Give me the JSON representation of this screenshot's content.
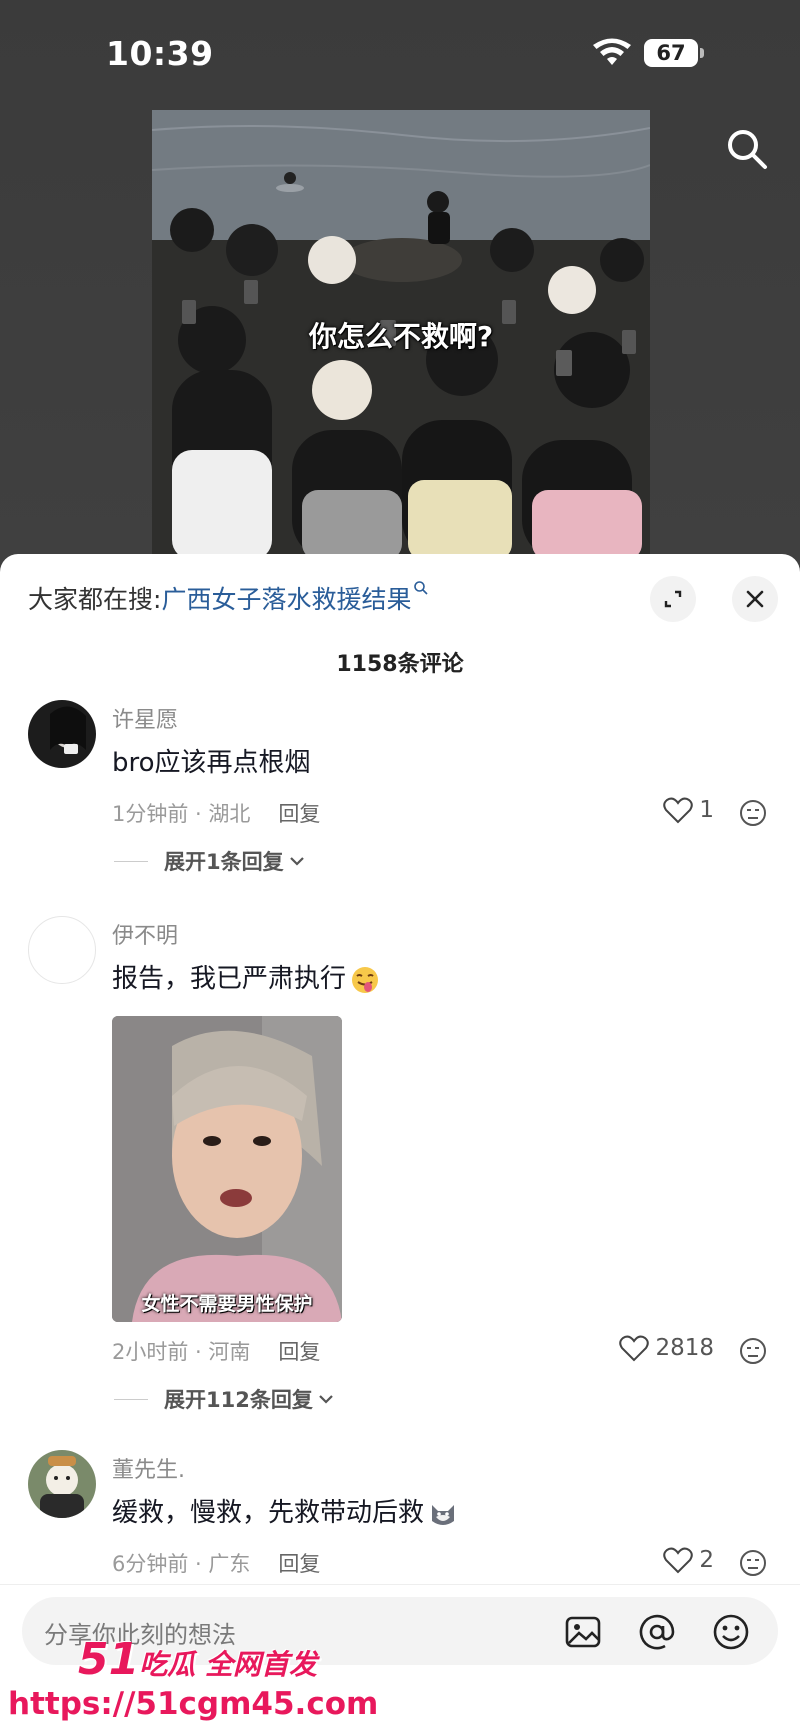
{
  "status_bar": {
    "time": "10:39",
    "battery": "67"
  },
  "video": {
    "caption": "你怎么不救啊?"
  },
  "sheet": {
    "search_hint_prefix": "大家都在搜:",
    "search_hint_query": "广西女子落水救援结果",
    "comment_count": "1158条评论"
  },
  "comments": [
    {
      "username": "许星愿",
      "text": "bro应该再点根烟",
      "meta": "1分钟前 · 湖北",
      "reply": "回复",
      "likes": "1",
      "expand": "展开1条回复"
    },
    {
      "username": "伊不明",
      "text": "报告，我已严肃执行",
      "image_caption": "女性不需要男性保护",
      "meta": "2小时前 · 河南",
      "reply": "回复",
      "likes": "2818",
      "expand": "展开112条回复"
    },
    {
      "username": "董先生.",
      "text": "缓救，慢救，先救带动后救",
      "meta": "6分钟前 · 广东",
      "reply": "回复",
      "likes": "2"
    }
  ],
  "input": {
    "placeholder": "分享你此刻的想法"
  },
  "watermark": {
    "logo_num": "51",
    "logo_text": "吃瓜 全网首发",
    "url": "https://51cgm45.com"
  },
  "colors": {
    "link": "#2a5d99",
    "watermark": "#e8185c"
  }
}
